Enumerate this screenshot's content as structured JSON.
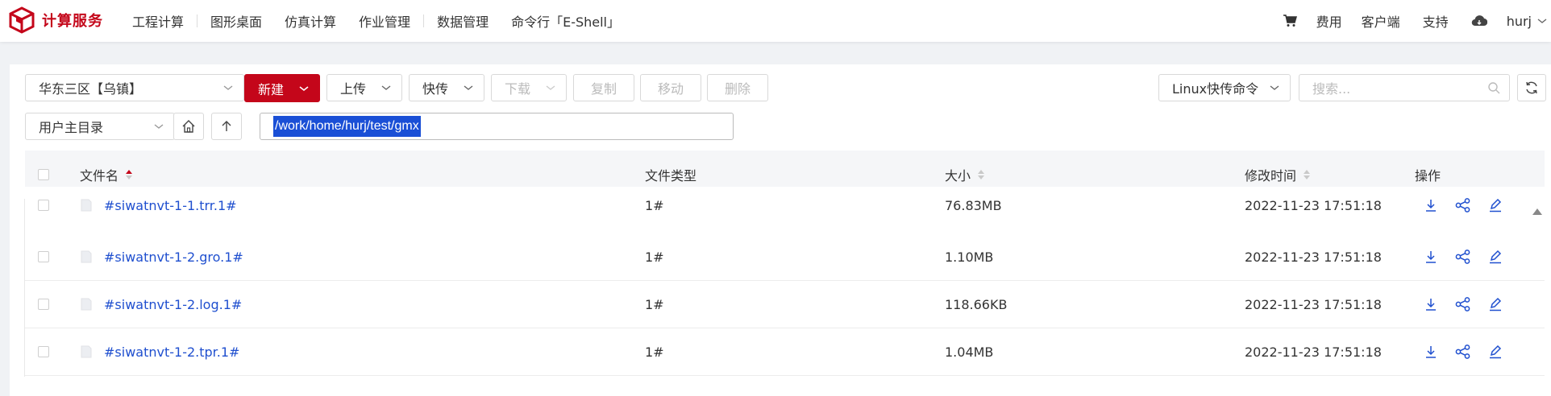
{
  "app": {
    "title": "计算服务"
  },
  "nav": {
    "items": [
      "工程计算",
      "图形桌面",
      "仿真计算",
      "作业管理",
      "数据管理",
      "命令行「E-Shell」"
    ],
    "fees": "费用",
    "client": "客户端",
    "support": "支持",
    "user": "hurj"
  },
  "toolbar": {
    "region": "华东三区【乌镇】",
    "new": "新建",
    "upload": "上传",
    "quick_transfer": "快传",
    "download": "下载",
    "copy": "复制",
    "move": "移动",
    "delete": "删除",
    "linux_cmd": "Linux快传命令",
    "search_placeholder": "搜索...",
    "root_dir": "用户主目录",
    "path": "/work/home/hurj/test/gmx"
  },
  "table": {
    "columns": [
      "文件名",
      "文件类型",
      "大小",
      "修改时间",
      "操作"
    ],
    "rows": [
      {
        "name": "#siwatnvt-1-1.trr.1#",
        "type": "1#",
        "size": "76.83MB",
        "modified": "2022-11-23 17:51:18"
      },
      {
        "name": "#siwatnvt-1-2.gro.1#",
        "type": "1#",
        "size": "1.10MB",
        "modified": "2022-11-23 17:51:18"
      },
      {
        "name": "#siwatnvt-1-2.log.1#",
        "type": "1#",
        "size": "118.66KB",
        "modified": "2022-11-23 17:51:18"
      },
      {
        "name": "#siwatnvt-1-2.tpr.1#",
        "type": "1#",
        "size": "1.04MB",
        "modified": "2022-11-23 17:51:18"
      }
    ]
  },
  "colors": {
    "brand": "#c4061a",
    "link": "#1f4fcf",
    "selection": "#1a4fd6"
  },
  "icons": [
    "cube-logo-icon",
    "cart-icon",
    "cloud-icon",
    "chevron-down-icon",
    "home-icon",
    "arrow-up-icon",
    "refresh-icon",
    "search-icon",
    "file-icon",
    "download-icon",
    "share-icon",
    "edit-icon",
    "sort-icon"
  ]
}
